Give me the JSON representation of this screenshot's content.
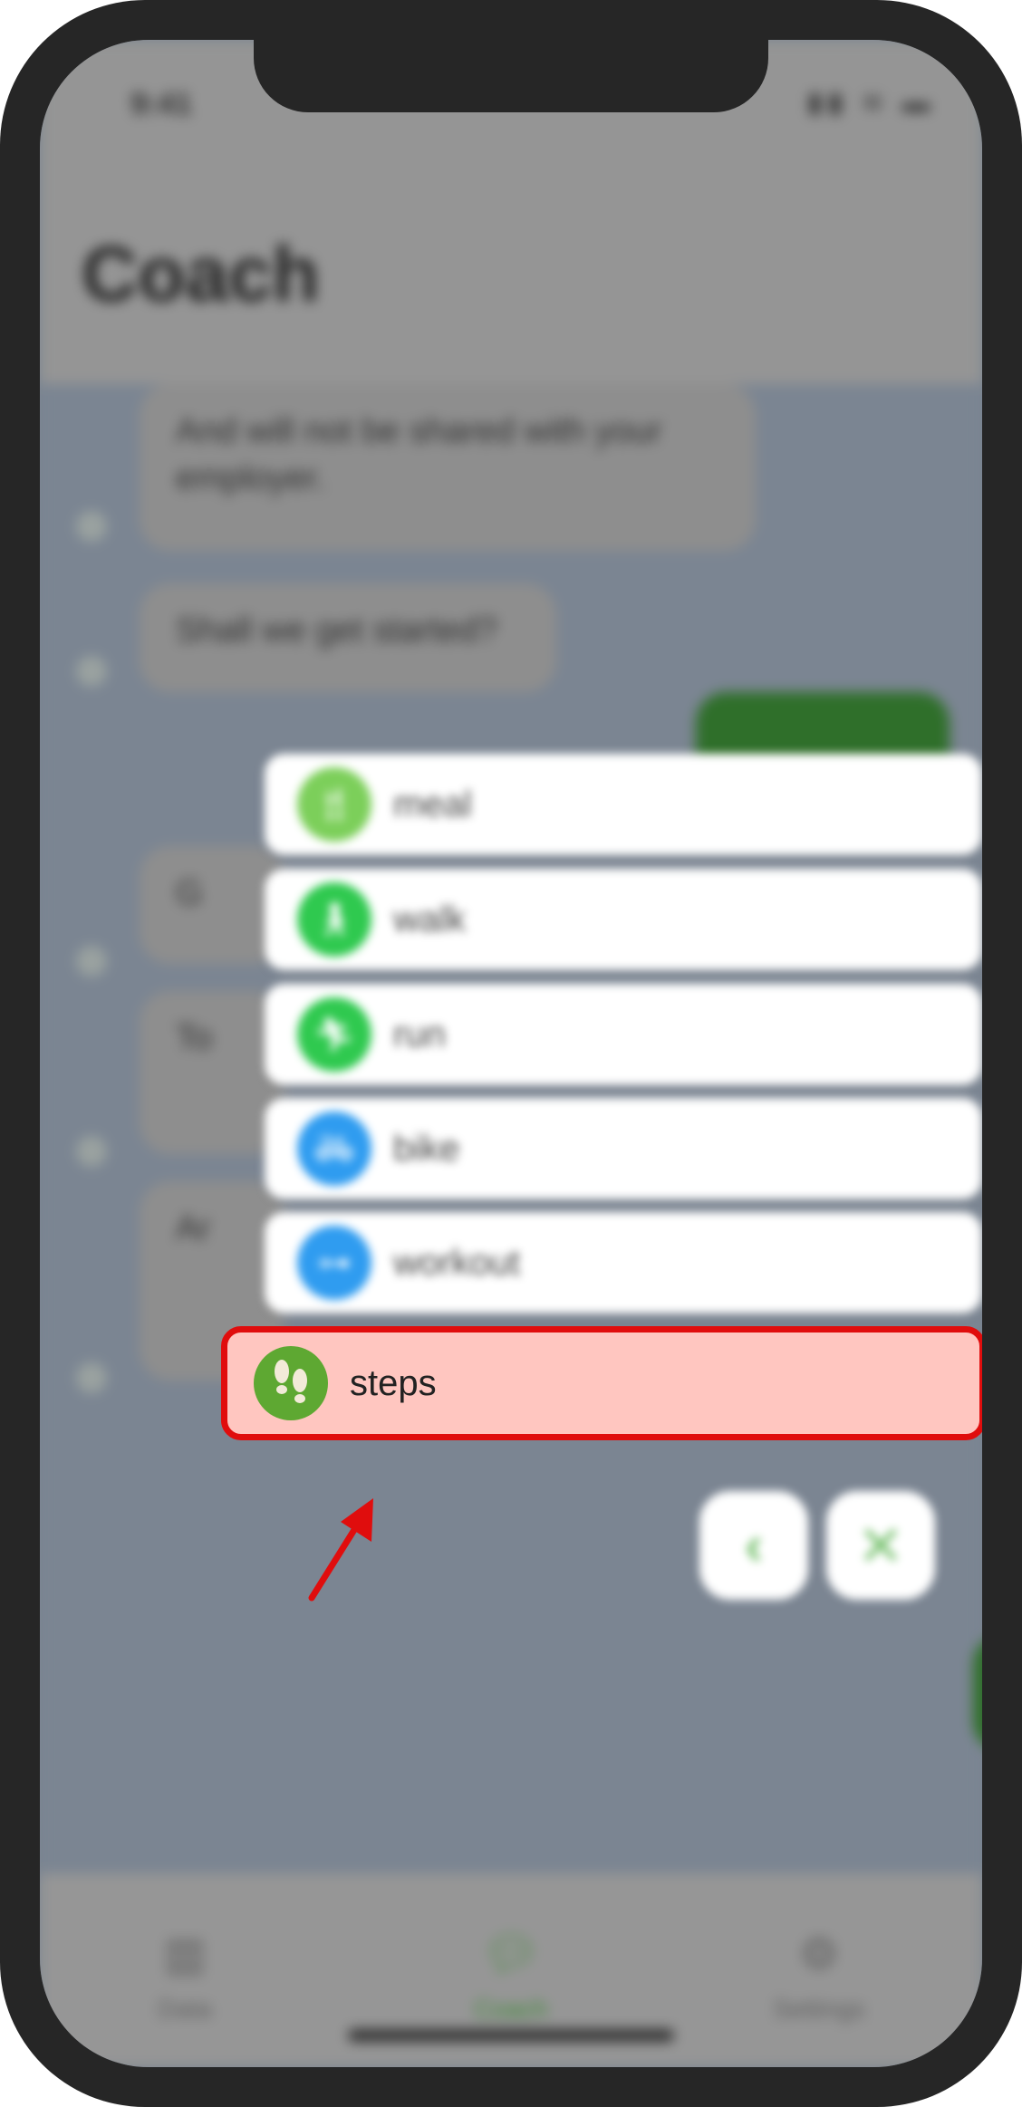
{
  "status_bar": {
    "time": "9:41",
    "icons": "▮▮ ≋ ▬"
  },
  "page_title": "Coach",
  "messages": [
    {
      "text": "And will not be shared with your employer.",
      "from": "coach"
    },
    {
      "text": "Shall we get started?",
      "from": "coach"
    },
    {
      "text": "",
      "from": "user"
    },
    {
      "text": "G",
      "from": "coach"
    },
    {
      "text": "To",
      "from": "coach"
    },
    {
      "text": "Ar",
      "from": "coach"
    }
  ],
  "activity_menu": {
    "items": [
      {
        "label": "meal",
        "icon": "fork-knife-icon",
        "color": "#7ccf5a"
      },
      {
        "label": "walk",
        "icon": "walker-icon",
        "color": "#2fc94f"
      },
      {
        "label": "run",
        "icon": "runner-icon",
        "color": "#2fc94f"
      },
      {
        "label": "bike",
        "icon": "bicycle-icon",
        "color": "#2f9cf0"
      },
      {
        "label": "workout",
        "icon": "dumbbell-icon",
        "color": "#2f9cf0"
      },
      {
        "label": "steps",
        "icon": "footprints-icon",
        "color": "#5ea832"
      }
    ],
    "back_icon": "‹",
    "close_icon": "✕",
    "highlight_color": "#e00d0d"
  },
  "tabbar": {
    "tabs": [
      {
        "label": "Data",
        "icon": "chart-icon"
      },
      {
        "label": "Coach",
        "icon": "chat-icon",
        "active": true
      },
      {
        "label": "Settings",
        "icon": "gear-icon"
      }
    ]
  }
}
